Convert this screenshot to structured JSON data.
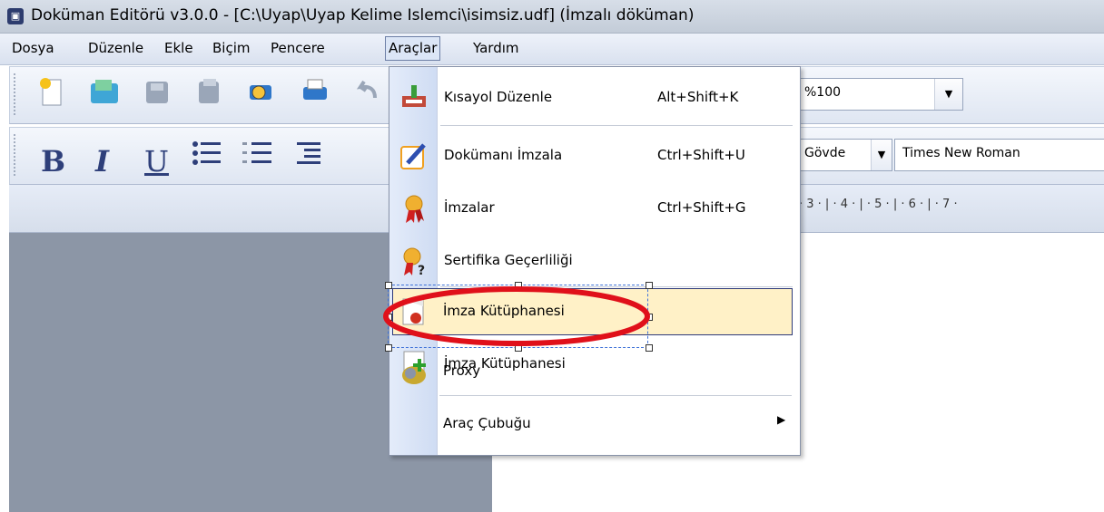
{
  "window": {
    "title": "Doküman Editörü v3.0.0 - [C:\\Uyap\\Uyap Kelime Islemci\\isimsiz.udf] (İmzalı döküman)"
  },
  "menubar": {
    "items": [
      "Dosya",
      "Düzenle",
      "Ekle",
      "Biçim",
      "Pencere",
      "Araçlar",
      "Yardım"
    ],
    "active": "Araçlar"
  },
  "toolbar": {
    "zoom_value": "%100",
    "style_value": "Gövde",
    "font_value": "Times New Roman",
    "bold_label": "B",
    "italic_label": "I",
    "underline_label": "U"
  },
  "ruler": {
    "text": "· 3 · | · 4 · | · 5 · | · 6 · | · 7 ·"
  },
  "araclar_menu": {
    "items": [
      {
        "label": "Kısayol Düzenle",
        "shortcut": "Alt+Shift+K",
        "icon": "shortcut-edit-icon"
      },
      {
        "label": "Dokümanı İmzala",
        "shortcut": "Ctrl+Shift+U",
        "icon": "sign-document-icon"
      },
      {
        "label": "İmzalar",
        "shortcut": "Ctrl+Shift+G",
        "icon": "signatures-ribbon-icon"
      },
      {
        "label": "Sertifika Geçerliliği",
        "shortcut": "",
        "icon": "certificate-validity-icon"
      },
      {
        "label": "İmza Kütüphanesi",
        "shortcut": "",
        "icon": "signature-library-icon"
      },
      {
        "label": "Proxy",
        "shortcut": "",
        "icon": "proxy-icon"
      },
      {
        "label": "Araç Çubuğu",
        "shortcut": "",
        "icon": "",
        "submenu": true
      }
    ],
    "highlighted": "İmza Kütüphanesi"
  },
  "colors": {
    "highlight_bg": "#fff1c7",
    "annotation_red": "#e0101a",
    "selection_blue": "#3f72d8"
  }
}
